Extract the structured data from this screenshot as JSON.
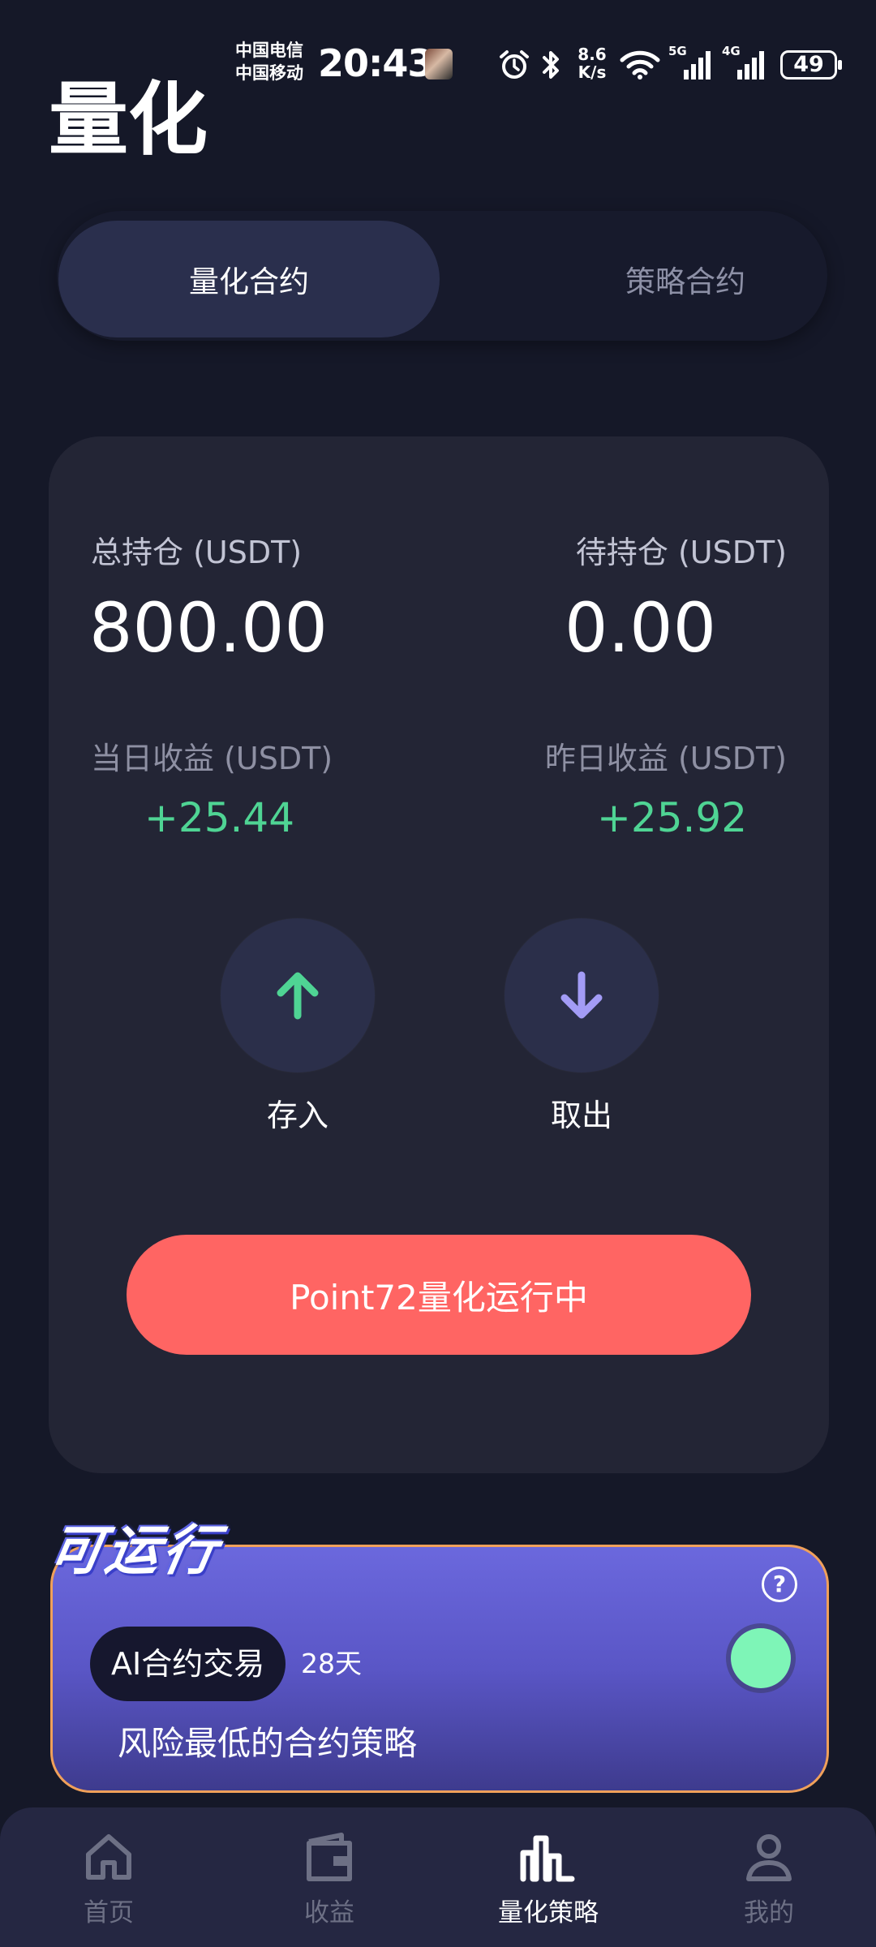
{
  "status_bar": {
    "carrier_1": "中国电信",
    "carrier_2": "中国移动",
    "time": "20:43",
    "net_speed_value": "8.6",
    "net_speed_unit": "K/s",
    "net_5g": "5G",
    "net_4g": "4G",
    "battery": "49",
    "icons": [
      "alarm-icon",
      "bluetooth-icon",
      "wifi-icon",
      "signal-icon",
      "battery-icon"
    ]
  },
  "header": {
    "title": "量化"
  },
  "tabs": [
    {
      "label": "量化合约",
      "active": true
    },
    {
      "label": "策略合约",
      "active": false
    }
  ],
  "summary": {
    "total_position_label": "总持仓 (USDT)",
    "total_position_value": "800.00",
    "pending_position_label": "待持仓 (USDT)",
    "pending_position_value": "0.00",
    "today_income_label": "当日收益 (USDT)",
    "today_income_value": "+25.44",
    "yesterday_income_label": "昨日收益 (USDT)",
    "yesterday_income_value": "+25.92"
  },
  "actions": {
    "deposit_label": "存入",
    "withdraw_label": "取出",
    "run_button_label": "Point72量化运行中"
  },
  "strategy": {
    "badge": "可运行",
    "name": "AI合约交易",
    "duration": "28天",
    "description": "风险最低的合约策略",
    "help_glyph": "?",
    "enabled": true
  },
  "bottom_nav": [
    {
      "label": "首页",
      "icon": "home-icon",
      "active": false
    },
    {
      "label": "收益",
      "icon": "wallet-icon",
      "active": false
    },
    {
      "label": "量化策略",
      "icon": "bar-chart-icon",
      "active": true
    },
    {
      "label": "我的",
      "icon": "user-icon",
      "active": false
    }
  ],
  "colors": {
    "background": "#151828",
    "card": "#232535",
    "gain": "#4fd494",
    "run_button": "#ff6563",
    "strategy_card": "#6b68dd",
    "toggle_on": "#7ef5b7"
  }
}
